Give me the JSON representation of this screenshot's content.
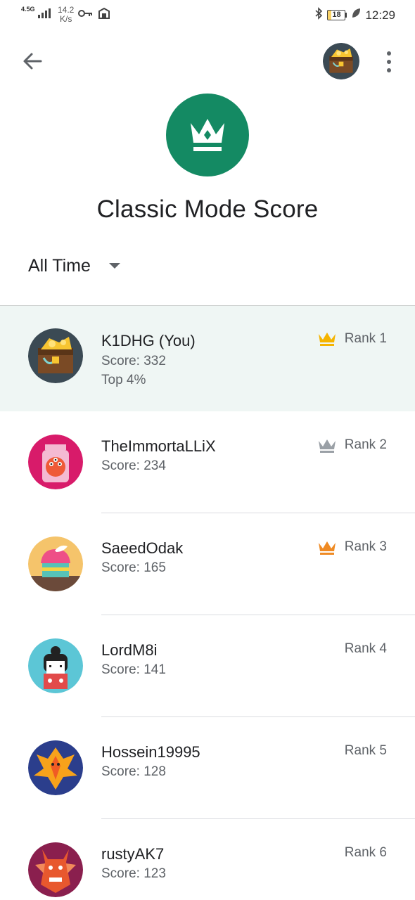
{
  "status_bar": {
    "network": "4.5G",
    "speed_value": "14.2",
    "speed_unit": "K/s",
    "battery": "18",
    "time": "12:29"
  },
  "app_bar": {
    "back_icon": "arrow-back-icon",
    "more_icon": "more-vert-icon"
  },
  "header": {
    "badge_icon": "crown-icon",
    "badge_color": "#148a63",
    "title": "Classic Mode Score"
  },
  "filter": {
    "selected": "All Time"
  },
  "colors": {
    "gold": "#f5b400",
    "silver": "#9aa0a6",
    "bronze": "#ef8a23",
    "highlight_row": "#eff6f4"
  },
  "players": [
    {
      "name": "K1DHG (You)",
      "score": "Score: 332",
      "top": "Top 4%",
      "rank": "Rank 1",
      "avatar": "treasure-chest-avatar",
      "crown": "gold"
    },
    {
      "name": "TheImmortaLLiX",
      "score": "Score: 234",
      "rank": "Rank 2",
      "avatar": "jar-monster-avatar",
      "crown": "silver"
    },
    {
      "name": "SaeedOdak",
      "score": "Score: 165",
      "rank": "Rank 3",
      "avatar": "cupcake-avatar",
      "crown": "bronze"
    },
    {
      "name": "LordM8i",
      "score": "Score: 141",
      "rank": "Rank 4",
      "avatar": "kokeshi-doll-avatar"
    },
    {
      "name": "Hossein19995",
      "score": "Score: 128",
      "rank": "Rank 5",
      "avatar": "phoenix-avatar"
    },
    {
      "name": "rustyAK7",
      "score": "Score: 123",
      "rank": "Rank 6",
      "avatar": "dragon-avatar"
    }
  ]
}
